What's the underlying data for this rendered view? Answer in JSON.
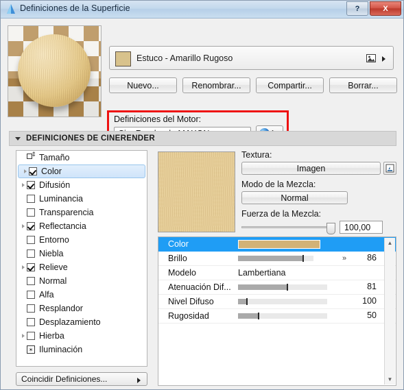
{
  "window": {
    "title": "Definiciones de la Superficie",
    "help_label": "?",
    "close_label": "X"
  },
  "material": {
    "name": "Estuco - Amarillo Rugoso",
    "swatch_color": "#d8c28c",
    "picture_icon": "picture-icon"
  },
  "buttons": {
    "new": "Nuevo...",
    "rename": "Renombrar...",
    "share": "Compartir...",
    "delete": "Borrar..."
  },
  "engine": {
    "label": "Definiciones del Motor:",
    "selected": "CineRender de MAXON",
    "info_label": "i",
    "highlight_color": "#ee1111"
  },
  "section": {
    "title": "DEFINICIONES DE CINERENDER"
  },
  "channels": [
    {
      "label": "Tamaño",
      "icon": "size-icon",
      "checkbox": false,
      "checked": false,
      "expand": false,
      "selected": false
    },
    {
      "label": "Color",
      "icon": null,
      "checkbox": true,
      "checked": true,
      "expand": true,
      "selected": true
    },
    {
      "label": "Difusión",
      "icon": null,
      "checkbox": true,
      "checked": true,
      "expand": true,
      "selected": false
    },
    {
      "label": "Luminancia",
      "icon": null,
      "checkbox": true,
      "checked": false,
      "expand": false,
      "selected": false
    },
    {
      "label": "Transparencia",
      "icon": null,
      "checkbox": true,
      "checked": false,
      "expand": false,
      "selected": false
    },
    {
      "label": "Reflectancia",
      "icon": null,
      "checkbox": true,
      "checked": true,
      "expand": true,
      "selected": false
    },
    {
      "label": "Entorno",
      "icon": null,
      "checkbox": true,
      "checked": false,
      "expand": false,
      "selected": false
    },
    {
      "label": "Niebla",
      "icon": null,
      "checkbox": true,
      "checked": false,
      "expand": false,
      "selected": false
    },
    {
      "label": "Relieve",
      "icon": null,
      "checkbox": true,
      "checked": true,
      "expand": true,
      "selected": false
    },
    {
      "label": "Normal",
      "icon": null,
      "checkbox": true,
      "checked": false,
      "expand": false,
      "selected": false
    },
    {
      "label": "Alfa",
      "icon": null,
      "checkbox": true,
      "checked": false,
      "expand": false,
      "selected": false
    },
    {
      "label": "Resplandor",
      "icon": null,
      "checkbox": true,
      "checked": false,
      "expand": false,
      "selected": false
    },
    {
      "label": "Desplazamiento",
      "icon": null,
      "checkbox": true,
      "checked": false,
      "expand": false,
      "selected": false
    },
    {
      "label": "Hierba",
      "icon": null,
      "checkbox": true,
      "checked": false,
      "expand": true,
      "selected": false
    },
    {
      "label": "Iluminación",
      "icon": "lamp-icon",
      "checkbox": false,
      "checked": false,
      "expand": false,
      "selected": false
    }
  ],
  "match_button": "Coincidir Definiciones...",
  "texture_panel": {
    "texture_label": "Textura:",
    "texture_value": "Imagen",
    "load_icon": "load-image-icon",
    "blend_mode_label": "Modo de la Mezcla:",
    "blend_mode_value": "Normal",
    "blend_strength_label": "Fuerza de la Mezcla:",
    "blend_strength_value": "100,00",
    "blend_strength_percent": 100,
    "preview_color": "#e3c88e"
  },
  "params": [
    {
      "name": "Color",
      "kind": "swatch",
      "swatch": "#d2b277",
      "value": "",
      "percent": 0,
      "selected": true
    },
    {
      "name": "Brillo",
      "kind": "slider",
      "value": "86",
      "percent": 86,
      "chevron": true,
      "selected": false
    },
    {
      "name": "Modelo",
      "kind": "text",
      "value": "Lambertiana",
      "percent": 0,
      "selected": false
    },
    {
      "name": "Atenuación Dif...",
      "kind": "slider",
      "value": "81",
      "percent": 55,
      "chevron": false,
      "selected": false
    },
    {
      "name": "Nivel Difuso",
      "kind": "slider",
      "value": "100",
      "percent": 10,
      "chevron": false,
      "selected": false
    },
    {
      "name": "Rugosidad",
      "kind": "slider",
      "value": "50",
      "percent": 23,
      "chevron": false,
      "selected": false
    }
  ],
  "scrollbar": {
    "up": "▲",
    "down": "▼"
  }
}
